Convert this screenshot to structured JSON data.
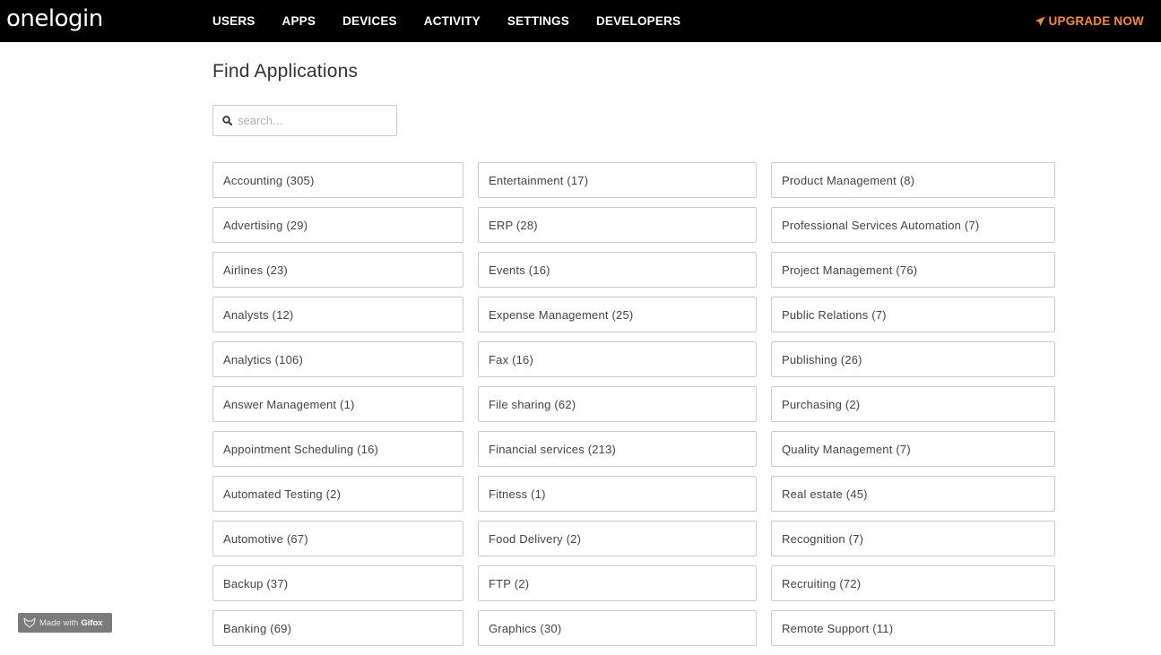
{
  "header": {
    "logo": "onelogin",
    "nav": [
      "USERS",
      "APPS",
      "DEVICES",
      "ACTIVITY",
      "SETTINGS",
      "DEVELOPERS"
    ],
    "upgrade_label": "UPGRADE NOW",
    "upgrade_color": "#ff8a1e",
    "background": "#000000"
  },
  "main": {
    "title": "Find Applications",
    "search_placeholder": "search...",
    "columns": [
      [
        "Accounting (305)",
        "Advertising (29)",
        "Airlines (23)",
        "Analysts (12)",
        "Analytics (106)",
        "Answer Management (1)",
        "Appointment Scheduling (16)",
        "Automated Testing (2)",
        "Automotive (67)",
        "Backup (37)",
        "Banking (69)"
      ],
      [
        "Entertainment (17)",
        "ERP (28)",
        "Events (16)",
        "Expense Management (25)",
        "Fax (16)",
        "File sharing (62)",
        "Financial services (213)",
        "Fitness (1)",
        "Food Delivery (2)",
        "FTP (2)",
        "Graphics (30)"
      ],
      [
        "Product Management (8)",
        "Professional Services Automation (7)",
        "Project Management (76)",
        "Public Relations (7)",
        "Publishing (26)",
        "Purchasing (2)",
        "Quality Management (7)",
        "Real estate (45)",
        "Recognition (7)",
        "Recruiting (72)",
        "Remote Support (11)"
      ]
    ]
  },
  "watermark": {
    "prefix": "Made with",
    "brand": "Gifox"
  }
}
